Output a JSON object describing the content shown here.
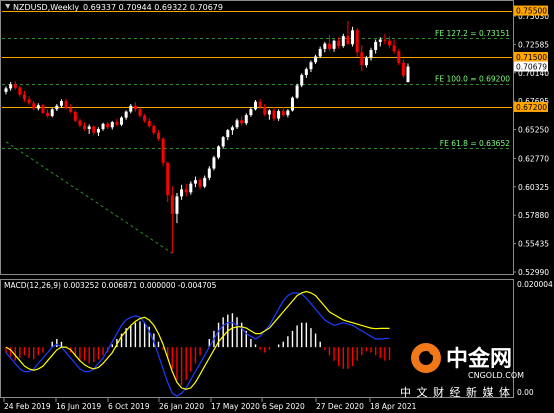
{
  "header": {
    "symbol": "NZDUSD,Weekly",
    "ohlc": "0.69337 0.70944 0.69322 0.70679"
  },
  "macd": {
    "label": "MACD(12,26,9) 0.003252 0.006871 0.000000 -0.004705",
    "ticks": [
      "0.020004",
      "0.00"
    ]
  },
  "price_axis": {
    "ticks": [
      "0.75030",
      "0.72585",
      "0.70140",
      "0.67695",
      "0.65250",
      "0.62770",
      "0.60325",
      "0.57880",
      "0.55435",
      "0.52990"
    ]
  },
  "price_labels": {
    "level_1": "0.75500",
    "level_2": "0.71500",
    "current": "0.70679",
    "level_3": "0.67200"
  },
  "fib_labels": {
    "fe_127": "FE 127.2 = 0.73151",
    "fe_100": "FE 100.0 = 0.69200",
    "fe_618": "FE 61.8 = 0.63652"
  },
  "time_axis": {
    "ticks": [
      "24 Feb 2019",
      "16 Jun 2019",
      "6 Oct 2019",
      "26 Jan 2020",
      "17 May 2020",
      "6 Sep 2020",
      "27 Dec 2020",
      "18 Apr 2021"
    ]
  },
  "watermark": {
    "brand": "中金网",
    "url": "CNGOLD.COM",
    "slogan": "中 文 财 经 新 媒 体"
  },
  "colors": {
    "background": "#000000",
    "up_candle": "#ffffff",
    "down_candle": "#ff0000",
    "level_line": "#ffa500",
    "fib_line": "#2e8b2e",
    "macd_signal": "#ffff00",
    "macd_line": "#1e3cff"
  },
  "chart_data": {
    "type": "candlestick",
    "symbol": "NZDUSD",
    "timeframe": "Weekly",
    "price_range": [
      0.5299,
      0.7615
    ],
    "horizontal_levels": [
      0.755,
      0.715,
      0.672
    ],
    "fib_levels": [
      0.73151,
      0.692,
      0.63652
    ],
    "current_price": 0.70679,
    "candles_ohlc": [
      [
        0.685,
        0.6895,
        0.6828,
        0.688
      ],
      [
        0.688,
        0.6935,
        0.686,
        0.6915
      ],
      [
        0.6915,
        0.6942,
        0.6868,
        0.6886
      ],
      [
        0.6886,
        0.69,
        0.681,
        0.6826
      ],
      [
        0.6826,
        0.6858,
        0.6765,
        0.6785
      ],
      [
        0.6785,
        0.6812,
        0.6735,
        0.6752
      ],
      [
        0.6752,
        0.6773,
        0.669,
        0.6706
      ],
      [
        0.6706,
        0.6752,
        0.669,
        0.6735
      ],
      [
        0.6735,
        0.6745,
        0.666,
        0.6668
      ],
      [
        0.6668,
        0.6698,
        0.6628,
        0.6642
      ],
      [
        0.6642,
        0.671,
        0.663,
        0.67
      ],
      [
        0.67,
        0.6745,
        0.6685,
        0.673
      ],
      [
        0.673,
        0.6786,
        0.6712,
        0.6771
      ],
      [
        0.6771,
        0.679,
        0.6695,
        0.671
      ],
      [
        0.671,
        0.6745,
        0.6665,
        0.6677
      ],
      [
        0.6677,
        0.669,
        0.659,
        0.6602
      ],
      [
        0.6602,
        0.662,
        0.6545,
        0.656
      ],
      [
        0.656,
        0.6588,
        0.6515,
        0.653
      ],
      [
        0.653,
        0.657,
        0.6488,
        0.6552
      ],
      [
        0.6552,
        0.656,
        0.648,
        0.65
      ],
      [
        0.65,
        0.6545,
        0.647,
        0.653
      ],
      [
        0.653,
        0.6585,
        0.6515,
        0.6575
      ],
      [
        0.6575,
        0.659,
        0.653,
        0.6545
      ],
      [
        0.6545,
        0.66,
        0.6525,
        0.659
      ],
      [
        0.659,
        0.6618,
        0.6555,
        0.6568
      ],
      [
        0.6568,
        0.664,
        0.6555,
        0.6628
      ],
      [
        0.6628,
        0.669,
        0.661,
        0.668
      ],
      [
        0.668,
        0.6745,
        0.6665,
        0.673
      ],
      [
        0.673,
        0.676,
        0.668,
        0.67
      ],
      [
        0.67,
        0.671,
        0.663,
        0.6645
      ],
      [
        0.6645,
        0.666,
        0.6585,
        0.66
      ],
      [
        0.66,
        0.6625,
        0.654,
        0.6555
      ],
      [
        0.6555,
        0.657,
        0.648,
        0.6498
      ],
      [
        0.6498,
        0.652,
        0.643,
        0.6445
      ],
      [
        0.6445,
        0.646,
        0.621,
        0.624
      ],
      [
        0.624,
        0.625,
        0.59,
        0.596
      ],
      [
        0.596,
        0.604,
        0.546,
        0.58
      ],
      [
        0.58,
        0.598,
        0.572,
        0.595
      ],
      [
        0.595,
        0.605,
        0.592,
        0.601
      ],
      [
        0.601,
        0.606,
        0.595,
        0.5985
      ],
      [
        0.5985,
        0.608,
        0.5965,
        0.606
      ],
      [
        0.606,
        0.612,
        0.603,
        0.609
      ],
      [
        0.609,
        0.611,
        0.601,
        0.6035
      ],
      [
        0.6035,
        0.613,
        0.602,
        0.611
      ],
      [
        0.611,
        0.621,
        0.609,
        0.619
      ],
      [
        0.619,
        0.63,
        0.6175,
        0.6285
      ],
      [
        0.6285,
        0.639,
        0.627,
        0.638
      ],
      [
        0.638,
        0.647,
        0.636,
        0.646
      ],
      [
        0.646,
        0.653,
        0.6435,
        0.652
      ],
      [
        0.652,
        0.656,
        0.648,
        0.6545
      ],
      [
        0.6545,
        0.662,
        0.653,
        0.6605
      ],
      [
        0.6605,
        0.664,
        0.656,
        0.658
      ],
      [
        0.658,
        0.6665,
        0.6565,
        0.665
      ],
      [
        0.665,
        0.672,
        0.6635,
        0.67
      ],
      [
        0.67,
        0.678,
        0.669,
        0.6765
      ],
      [
        0.6765,
        0.679,
        0.6705,
        0.672
      ],
      [
        0.672,
        0.6745,
        0.664,
        0.6655
      ],
      [
        0.6655,
        0.67,
        0.661,
        0.669
      ],
      [
        0.669,
        0.672,
        0.66,
        0.662
      ],
      [
        0.662,
        0.67,
        0.66,
        0.6685
      ],
      [
        0.6685,
        0.672,
        0.6635,
        0.665
      ],
      [
        0.665,
        0.67,
        0.663,
        0.669
      ],
      [
        0.669,
        0.681,
        0.668,
        0.68
      ],
      [
        0.68,
        0.692,
        0.679,
        0.6905
      ],
      [
        0.6905,
        0.701,
        0.689,
        0.6995
      ],
      [
        0.6995,
        0.706,
        0.697,
        0.7045
      ],
      [
        0.7045,
        0.712,
        0.702,
        0.7105
      ],
      [
        0.7105,
        0.717,
        0.709,
        0.7155
      ],
      [
        0.7155,
        0.724,
        0.714,
        0.722
      ],
      [
        0.722,
        0.728,
        0.719,
        0.7265
      ],
      [
        0.7265,
        0.734,
        0.72,
        0.722
      ],
      [
        0.722,
        0.73,
        0.7195,
        0.729
      ],
      [
        0.729,
        0.732,
        0.722,
        0.7245
      ],
      [
        0.7245,
        0.735,
        0.723,
        0.733
      ],
      [
        0.733,
        0.746,
        0.731,
        0.726
      ],
      [
        0.726,
        0.741,
        0.724,
        0.738
      ],
      [
        0.738,
        0.74,
        0.715,
        0.719
      ],
      [
        0.719,
        0.725,
        0.703,
        0.708
      ],
      [
        0.708,
        0.716,
        0.706,
        0.714
      ],
      [
        0.714,
        0.723,
        0.712,
        0.721
      ],
      [
        0.721,
        0.73,
        0.718,
        0.728
      ],
      [
        0.728,
        0.732,
        0.724,
        0.73
      ],
      [
        0.73,
        0.735,
        0.726,
        0.729
      ],
      [
        0.729,
        0.733,
        0.723,
        0.725
      ],
      [
        0.725,
        0.73,
        0.718,
        0.72
      ],
      [
        0.72,
        0.722,
        0.708,
        0.71
      ],
      [
        0.71,
        0.713,
        0.697,
        0.699
      ],
      [
        0.6934,
        0.7094,
        0.6932,
        0.7068
      ]
    ],
    "macd_range": [
      -0.018,
      0.024
    ],
    "macd_histogram": [
      -0.002,
      -0.0035,
      -0.005,
      -0.004,
      -0.003,
      -0.004,
      -0.0045,
      -0.003,
      -0.002,
      0.0,
      0.002,
      0.003,
      0.002,
      0.0,
      -0.002,
      -0.0035,
      -0.0045,
      -0.005,
      -0.006,
      -0.0055,
      -0.0045,
      -0.003,
      -0.002,
      0.001,
      0.003,
      0.005,
      0.007,
      0.008,
      0.009,
      0.0095,
      0.009,
      0.0075,
      0.005,
      0.002,
      -0.001,
      -0.004,
      -0.008,
      -0.012,
      -0.014,
      -0.012,
      -0.009,
      -0.006,
      -0.003,
      0.0,
      0.003,
      0.006,
      0.009,
      0.011,
      0.012,
      0.0125,
      0.011,
      0.009,
      0.006,
      0.003,
      0.001,
      -0.001,
      -0.002,
      -0.001,
      0.0,
      0.001,
      0.002,
      0.004,
      0.006,
      0.008,
      0.009,
      0.009,
      0.007,
      0.005,
      0.002,
      -0.001,
      -0.003,
      -0.005,
      -0.007,
      -0.008,
      -0.008,
      -0.007,
      -0.005,
      -0.003,
      -0.0015,
      -0.002,
      -0.003,
      -0.004,
      -0.005,
      -0.0047
    ],
    "macd_main": [
      -0.002,
      -0.004,
      -0.006,
      -0.008,
      -0.009,
      -0.009,
      -0.008,
      -0.006,
      -0.004,
      -0.002,
      0.0,
      0.001,
      0.0,
      -0.002,
      -0.004,
      -0.006,
      -0.008,
      -0.009,
      -0.009,
      -0.008,
      -0.006,
      -0.004,
      -0.001,
      0.002,
      0.005,
      0.008,
      0.01,
      0.011,
      0.0115,
      0.011,
      0.009,
      0.006,
      0.002,
      -0.003,
      -0.008,
      -0.013,
      -0.017,
      -0.018,
      -0.017,
      -0.015,
      -0.012,
      -0.009,
      -0.006,
      -0.003,
      0.0,
      0.003,
      0.006,
      0.008,
      0.009,
      0.009,
      0.008,
      0.007,
      0.005,
      0.004,
      0.003,
      0.004,
      0.006,
      0.008,
      0.011,
      0.014,
      0.017,
      0.019,
      0.02,
      0.02,
      0.0195,
      0.018,
      0.016,
      0.014,
      0.012,
      0.01,
      0.009,
      0.008,
      0.0085,
      0.009,
      0.0085,
      0.008,
      0.007,
      0.006,
      0.005,
      0.004,
      0.003,
      0.003,
      0.0032,
      0.0033
    ],
    "macd_signal": [
      0.0,
      -0.001,
      -0.003,
      -0.005,
      -0.007,
      -0.008,
      -0.0085,
      -0.008,
      -0.007,
      -0.005,
      -0.003,
      -0.001,
      0.0,
      0.0,
      -0.001,
      -0.003,
      -0.005,
      -0.0065,
      -0.0075,
      -0.008,
      -0.0075,
      -0.006,
      -0.004,
      -0.002,
      0.001,
      0.004,
      0.006,
      0.008,
      0.0095,
      0.0105,
      0.011,
      0.01,
      0.008,
      0.005,
      0.001,
      -0.004,
      -0.009,
      -0.013,
      -0.015,
      -0.0155,
      -0.015,
      -0.013,
      -0.01,
      -0.007,
      -0.004,
      -0.001,
      0.002,
      0.004,
      0.006,
      0.007,
      0.0075,
      0.0075,
      0.007,
      0.006,
      0.005,
      0.005,
      0.006,
      0.007,
      0.009,
      0.011,
      0.013,
      0.015,
      0.017,
      0.019,
      0.02,
      0.0205,
      0.02,
      0.019,
      0.017,
      0.015,
      0.013,
      0.012,
      0.011,
      0.01,
      0.0095,
      0.009,
      0.0085,
      0.008,
      0.0075,
      0.007,
      0.0068,
      0.0069,
      0.0069,
      0.0069
    ]
  }
}
